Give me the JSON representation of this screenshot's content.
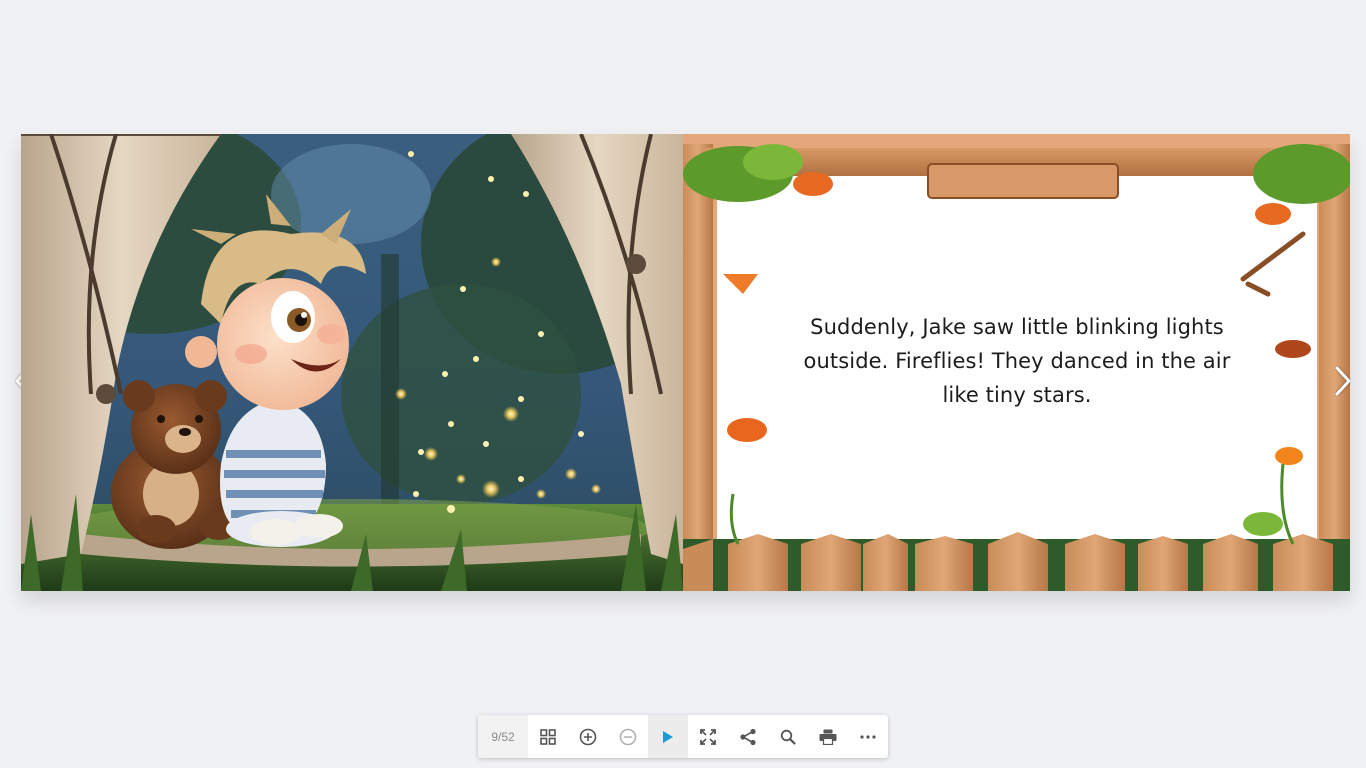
{
  "book": {
    "story_text": "Suddenly, Jake saw little blinking lights outside. Fireflies! They danced in the air like tiny stars."
  },
  "navigation": {
    "prev_icon": "chevron-left-icon",
    "next_icon": "chevron-right-icon"
  },
  "toolbar": {
    "page_counter": "9/52",
    "buttons": [
      {
        "name": "thumbnails-button",
        "icon": "grid-icon"
      },
      {
        "name": "zoom-in-button",
        "icon": "plus-circle-icon"
      },
      {
        "name": "zoom-out-button",
        "icon": "minus-circle-icon"
      },
      {
        "name": "autoplay-button",
        "icon": "play-icon"
      },
      {
        "name": "fullscreen-button",
        "icon": "expand-icon"
      },
      {
        "name": "share-button",
        "icon": "share-icon"
      },
      {
        "name": "search-button",
        "icon": "search-icon"
      },
      {
        "name": "print-button",
        "icon": "printer-icon"
      },
      {
        "name": "more-button",
        "icon": "more-horizontal-icon"
      }
    ]
  },
  "colors": {
    "background": "#f0f1f4",
    "play_accent": "#1a9bd7",
    "icon": "#555555",
    "icon_disabled": "#b0b0b0"
  }
}
